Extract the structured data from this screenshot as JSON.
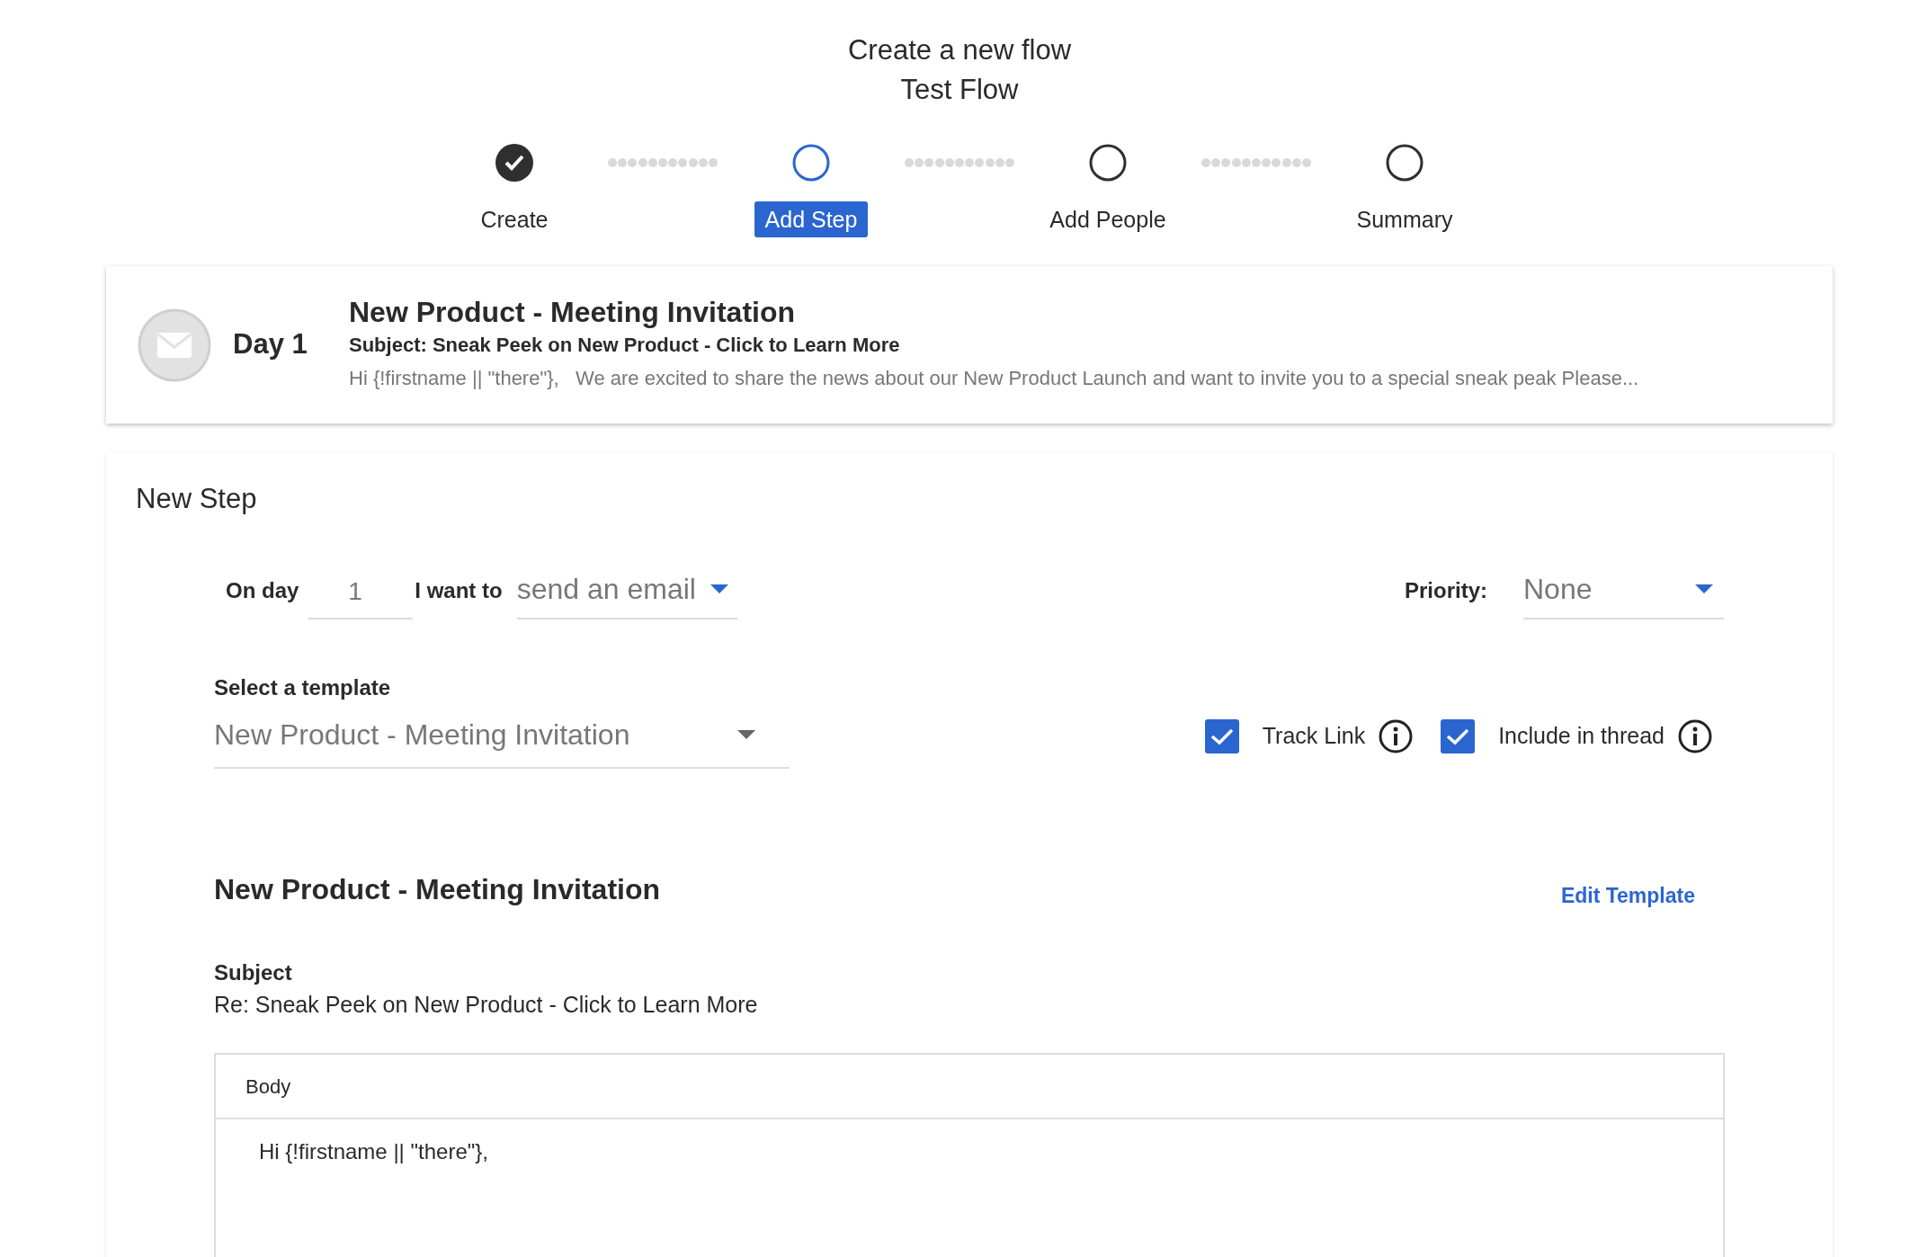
{
  "page": {
    "heading": "Create a new flow",
    "flow_name": "Test Flow"
  },
  "steps": [
    {
      "label": "Create",
      "done": true,
      "selected": false
    },
    {
      "label": "Add Step",
      "done": false,
      "selected": true
    },
    {
      "label": "Add People",
      "done": false,
      "selected": false
    },
    {
      "label": "Summary",
      "done": false,
      "selected": false
    }
  ],
  "last_step": {
    "day": "Day 1",
    "title": "New Product - Meeting Invitation",
    "subject": "Subject: Sneak Peek on New Product - Click to Learn More",
    "preview": "Hi {!firstname || \"there\"},   We are excited to share the news about our New Product Launch and want to invite you to a special sneak peak Please..."
  },
  "new_step": {
    "title": "New Step",
    "day_label": "On day",
    "day_value": "1",
    "action_label": "I want to",
    "action_value": "send an email",
    "priority_label": "Priority:",
    "priority_value": "None",
    "template_label": "Select a template",
    "template_value": "New Product - Meeting Invitation",
    "options": [
      {
        "label": "Track Link",
        "checked": true
      },
      {
        "label": "Include in thread",
        "checked": true
      }
    ]
  },
  "template": {
    "title": "New Product - Meeting Invitation",
    "edit_link": "Edit Template",
    "subject_label": "Subject",
    "subject": "Re: Sneak Peek on New Product - Click to Learn More",
    "body_label": "Body",
    "body": "Hi {!firstname || \"there\"},"
  }
}
